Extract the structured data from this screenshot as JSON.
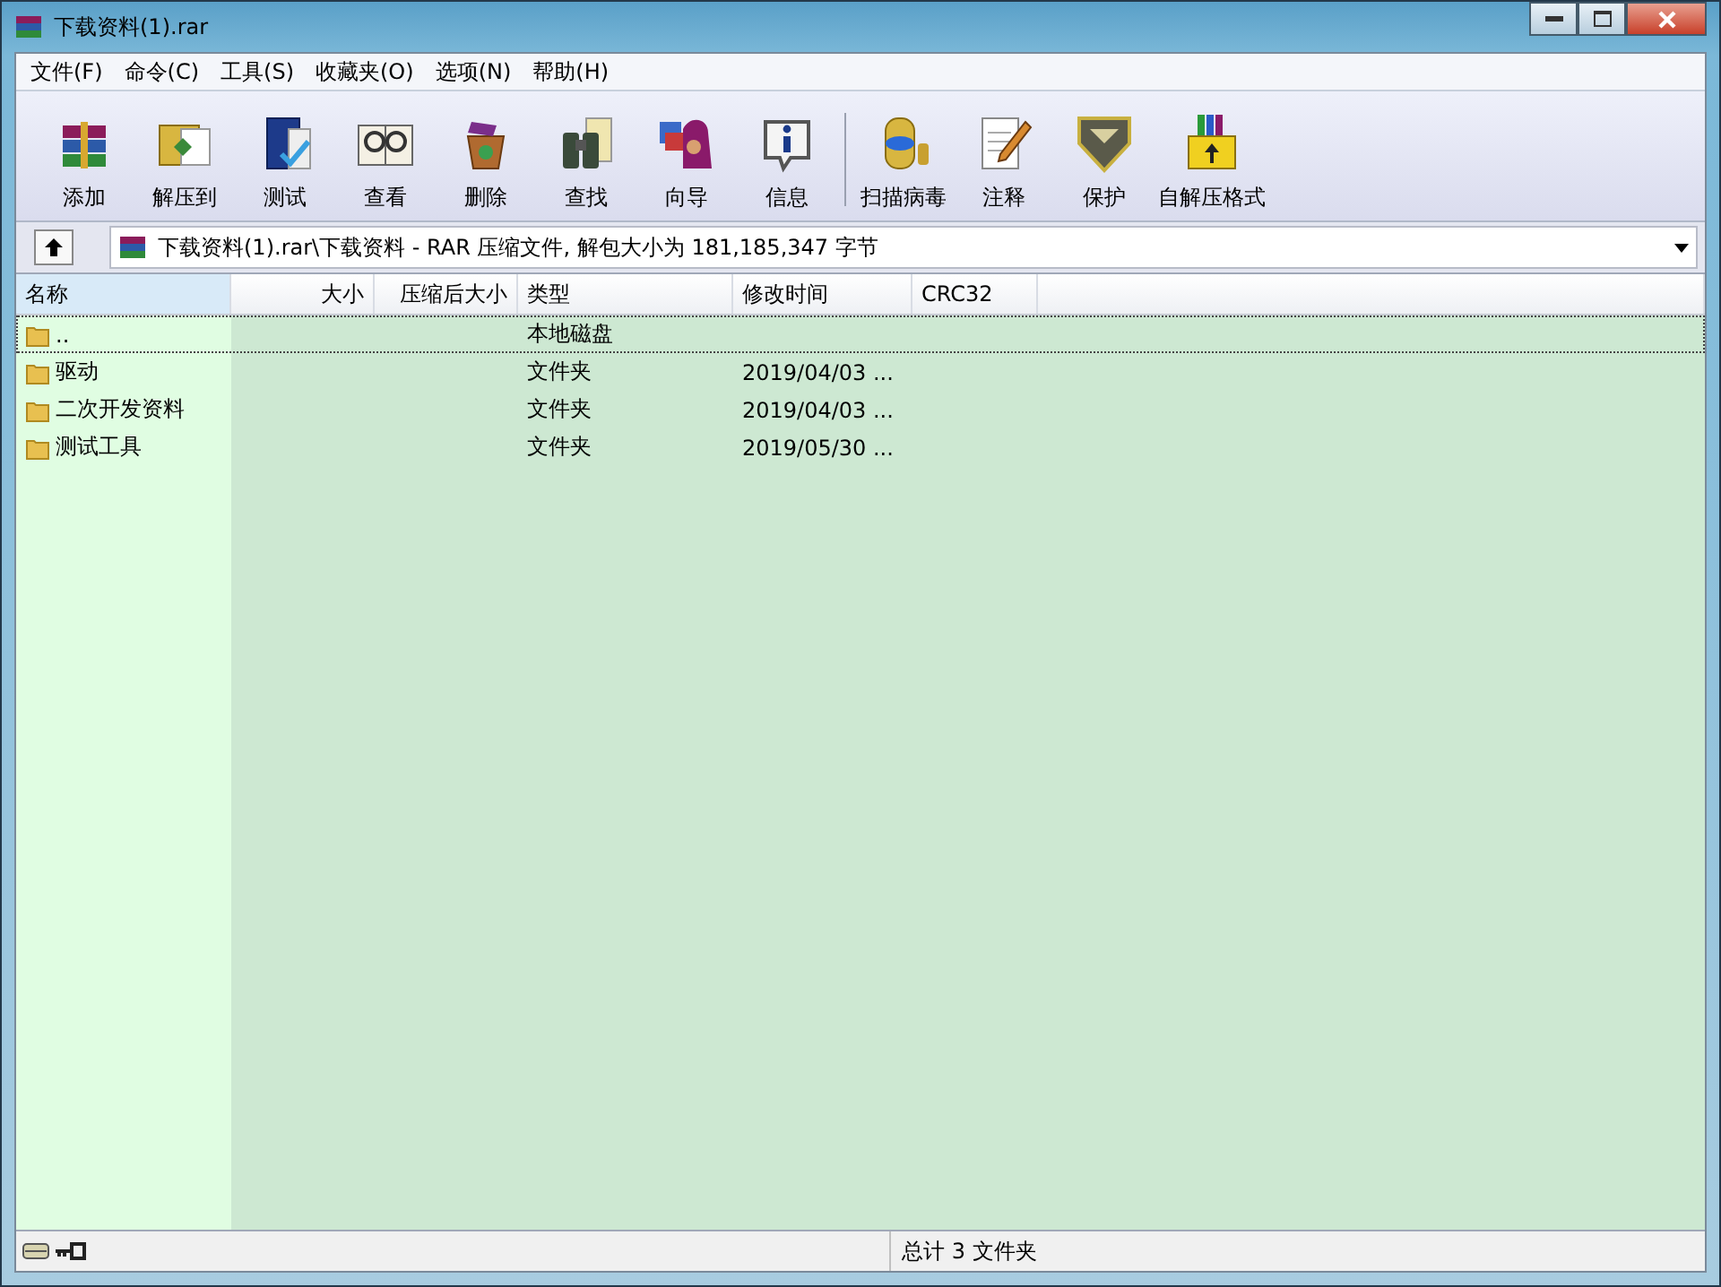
{
  "window": {
    "title": "下载资料(1).rar"
  },
  "menu": [
    "文件(F)",
    "命令(C)",
    "工具(S)",
    "收藏夹(O)",
    "选项(N)",
    "帮助(H)"
  ],
  "toolbar": [
    {
      "label": "添加",
      "separator_before": false
    },
    {
      "label": "解压到",
      "separator_before": false
    },
    {
      "label": "测试",
      "separator_before": false
    },
    {
      "label": "查看",
      "separator_before": false
    },
    {
      "label": "删除",
      "separator_before": false
    },
    {
      "label": "查找",
      "separator_before": false
    },
    {
      "label": "向导",
      "separator_before": false
    },
    {
      "label": "信息",
      "separator_before": false
    },
    {
      "label": "扫描病毒",
      "separator_before": true
    },
    {
      "label": "注释",
      "separator_before": false
    },
    {
      "label": "保护",
      "separator_before": false
    },
    {
      "label": "自解压格式",
      "separator_before": false
    }
  ],
  "address": {
    "path": "下载资料(1).rar\\下载资料 - RAR 压缩文件, 解包大小为 181,185,347 字节"
  },
  "table": {
    "columns": [
      {
        "label": "名称",
        "kind": "text"
      },
      {
        "label": "大小",
        "kind": "number"
      },
      {
        "label": "压缩后大小",
        "kind": "number"
      },
      {
        "label": "类型",
        "kind": "text"
      },
      {
        "label": "修改时间",
        "kind": "text"
      },
      {
        "label": "CRC32",
        "kind": "text"
      }
    ],
    "rows": [
      {
        "name": "..",
        "type": "本地磁盘",
        "focused": true
      },
      {
        "name": "驱动",
        "type": "文件夹",
        "modified": "2019/04/03 ...",
        "focused": false
      },
      {
        "name": "二次开发资料",
        "type": "文件夹",
        "modified": "2019/04/03 ...",
        "focused": false
      },
      {
        "name": "测试工具",
        "type": "文件夹",
        "modified": "2019/05/30 ...",
        "focused": false
      }
    ]
  },
  "status_bar": {
    "summary": "总计 3 文件夹"
  }
}
